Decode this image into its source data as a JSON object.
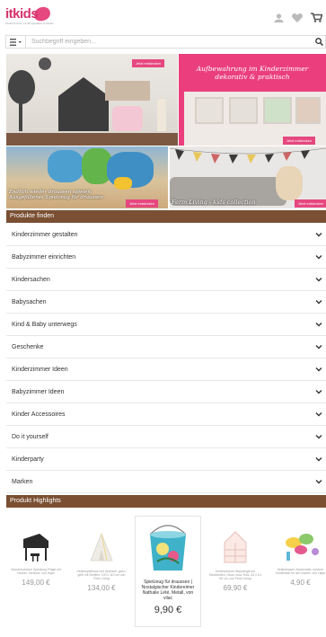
{
  "header": {
    "logo_text": "itkids",
    "logo_tagline": "Kinderzimmer mit Stil gestalten & kaufen"
  },
  "search": {
    "placeholder": "Suchbegriff eingeben..."
  },
  "banners": {
    "top_left_button": "Jetzt entdecken",
    "top_right_title_line1": "Aufbewahrung im Kinderzimmer",
    "top_right_title_line2": "dekorativ & praktisch",
    "top_right_button": "Jetzt entdecken",
    "bottom_left_caption_line1": "Endlich wieder draussen spielen:",
    "bottom_left_caption_line2": "Ausgefallenes Spielzeug für draussen",
    "bottom_left_button": "Jetzt entdecken",
    "bottom_right_caption": "Ferm Living - kids collection",
    "bottom_right_button": "Jetzt entdecken"
  },
  "finder": {
    "title": "Produkte finden",
    "categories": [
      "Kinderzimmer gestalten",
      "Babyzimmer einrichten",
      "Kindersachen",
      "Babysachen",
      "Kind & Baby unterwegs",
      "Geschenke",
      "Kinderzimmer Ideen",
      "Babyzimmer Ideen",
      "Kinder Accessoires",
      "Do it yourself",
      "Kinderparty",
      "Marken"
    ]
  },
  "highlights": {
    "title": "Produkt Highlights",
    "products": [
      {
        "title": "Wunderschöner Spielzeug Flügel mit Hocker, Schwarz, von Hape",
        "price": "149,00 €"
      },
      {
        "title": "Kinderspielhaus und Spielzelt, grau / gelb mit Streifen, 100 x 110 cm von Ferm Living",
        "price": "134,00 €"
      },
      {
        "title": "Spielzeug für draussen | Nostalgischer Kindereimer Nathalie Lété, Metall, von vilac",
        "price": "9,90 €"
      },
      {
        "title": "Kinderzimmer Wandregal mit Steckbetten, Haus, rosa, Holz, 33 x 6 x 50 cm, von Ferm Living",
        "price": "69,90 €"
      },
      {
        "title": "Seifenblasen Zauberstab, schöner Kinderstab für den Garten, von Hape",
        "price": "4,90 €"
      }
    ]
  },
  "colors": {
    "brand_pink": "#e6477f",
    "section_brown": "#7a4f32"
  }
}
